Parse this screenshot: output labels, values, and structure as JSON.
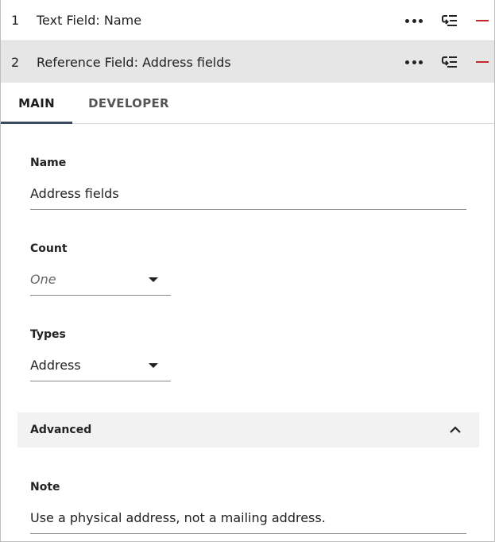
{
  "fields": [
    {
      "index": "1",
      "title": "Text Field: Name",
      "more_icon": "more-horizontal-icon",
      "reorder_icon": "reorder-list-icon",
      "remove_icon": "minus-icon"
    },
    {
      "index": "2",
      "title": "Reference Field: Address fields",
      "more_icon": "more-horizontal-icon",
      "reorder_icon": "reorder-list-icon",
      "remove_icon": "minus-icon"
    }
  ],
  "tabs": {
    "main": "MAIN",
    "developer": "DEVELOPER",
    "active": "MAIN"
  },
  "form": {
    "name_label": "Name",
    "name_value": "Address fields",
    "count_label": "Count",
    "count_placeholder": "One",
    "types_label": "Types",
    "types_value": "Address",
    "advanced_label": "Advanced",
    "advanced_icon": "chevron-up-icon",
    "note_label": "Note",
    "note_value": "Use a physical address, not a mailing address."
  },
  "colors": {
    "remove": "#c0282d",
    "active_tab_underline": "#3a4a5c",
    "selected_row_bg": "#e6e6e6",
    "section_bg": "#f2f2f2"
  }
}
